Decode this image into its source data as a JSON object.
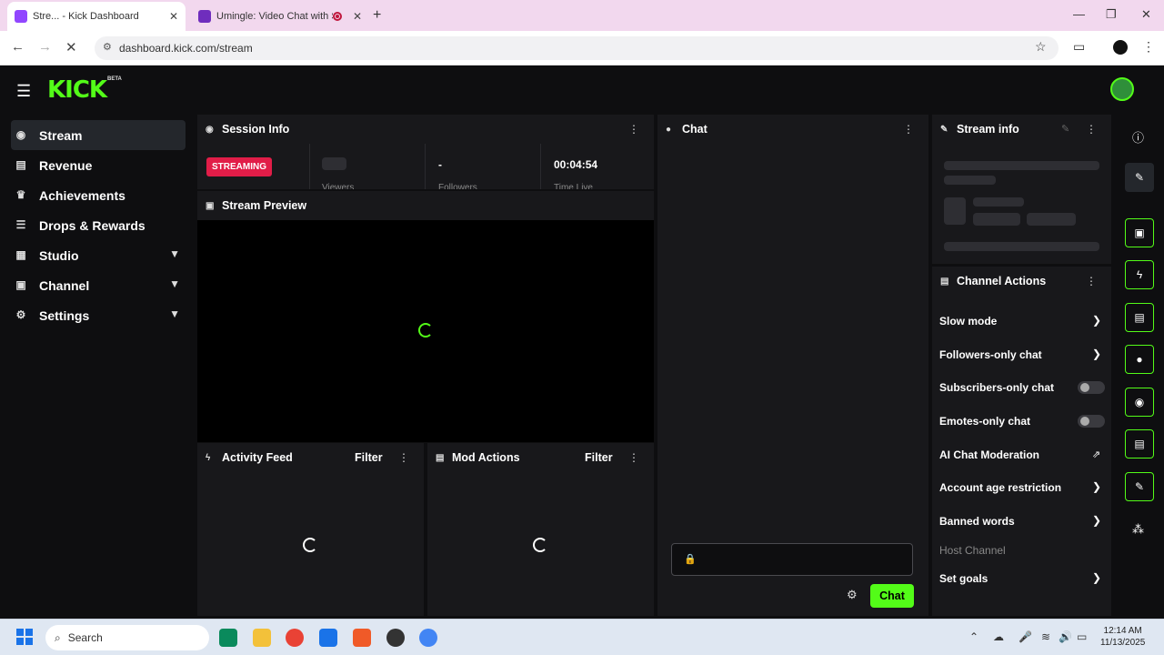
{
  "browser": {
    "tabs": [
      {
        "title": "Stre... - Kick Dashboard",
        "favicon_color": "#9146ff"
      },
      {
        "title": "Umingle: Video Chat with St",
        "favicon_color": "#6f2dbd"
      }
    ],
    "url": "dashboard.kick.com/stream"
  },
  "app": {
    "logo": "KICK",
    "logo_badge": "BETA",
    "accent": "#53fc18"
  },
  "sidebar": {
    "items": [
      {
        "label": "Stream",
        "icon": "broadcast-icon"
      },
      {
        "label": "Revenue",
        "icon": "chart-icon"
      },
      {
        "label": "Achievements",
        "icon": "trophy-icon"
      },
      {
        "label": "Drops & Rewards",
        "icon": "gift-icon"
      },
      {
        "label": "Studio",
        "icon": "studio-icon"
      },
      {
        "label": "Channel",
        "icon": "channel-icon"
      },
      {
        "label": "Settings",
        "icon": "gear-icon"
      }
    ]
  },
  "session": {
    "title": "Session Info",
    "status_badge": "STREAMING",
    "followers_value": "-",
    "time_live_value": "00:04:54",
    "viewers_label": "Viewers",
    "followers_label": "Followers",
    "time_live_label": "Time Live"
  },
  "preview": {
    "title": "Stream Preview"
  },
  "activity": {
    "title": "Activity Feed",
    "filter": "Filter"
  },
  "mod": {
    "title": "Mod Actions",
    "filter": "Filter"
  },
  "chat": {
    "title": "Chat",
    "send_label": "Chat"
  },
  "stream_info": {
    "title": "Stream info"
  },
  "channel_actions": {
    "title": "Channel Actions",
    "items": [
      {
        "label": "Slow mode",
        "control": "chevron"
      },
      {
        "label": "Followers-only chat",
        "control": "chevron"
      },
      {
        "label": "Subscribers-only chat",
        "control": "toggle-off"
      },
      {
        "label": "Emotes-only chat",
        "control": "toggle-off"
      },
      {
        "label": "AI Chat Moderation",
        "control": "external-link"
      },
      {
        "label": "Account age restriction",
        "control": "chevron"
      },
      {
        "label": "Banned words",
        "control": "chevron"
      },
      {
        "label": "Host Channel",
        "control": "disabled"
      },
      {
        "label": "Set goals",
        "control": "chevron"
      }
    ]
  },
  "taskbar": {
    "search_placeholder": "Search",
    "time": "12:14 AM",
    "date": "11/13/2025"
  }
}
